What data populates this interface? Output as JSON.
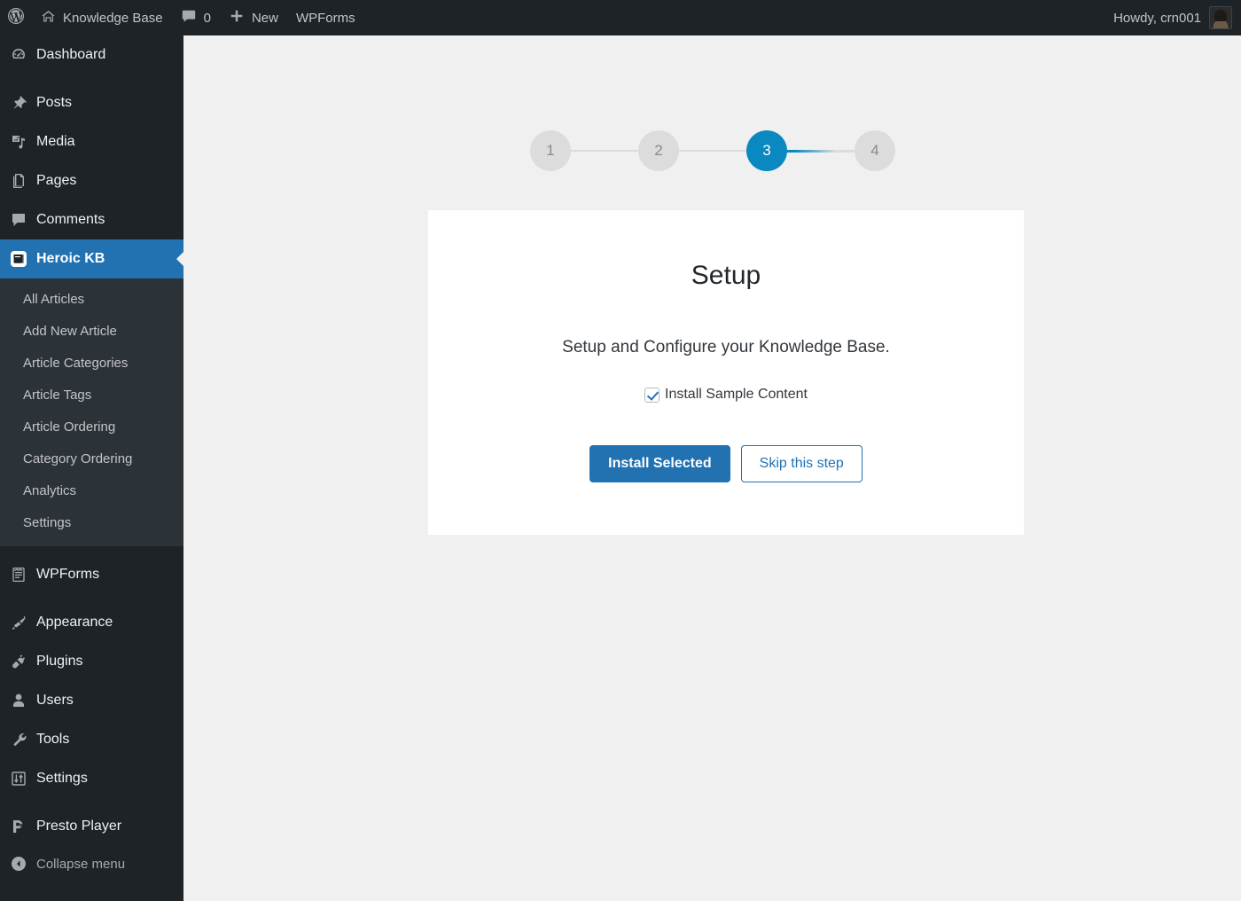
{
  "adminbar": {
    "wp_logo": "wordpress-logo",
    "site_name": "Knowledge Base",
    "comments_count": "0",
    "new_label": "New",
    "wpforms_label": "WPForms",
    "howdy": "Howdy, crn001"
  },
  "sidebar": {
    "items": [
      {
        "label": "Dashboard",
        "icon": "dashboard-icon",
        "current": false,
        "sep_after": true
      },
      {
        "label": "Posts",
        "icon": "pin-icon",
        "current": false,
        "sep_after": false
      },
      {
        "label": "Media",
        "icon": "media-icon",
        "current": false,
        "sep_after": false
      },
      {
        "label": "Pages",
        "icon": "pages-icon",
        "current": false,
        "sep_after": false
      },
      {
        "label": "Comments",
        "icon": "comment-icon",
        "current": false,
        "sep_after": false
      },
      {
        "label": "Heroic KB",
        "icon": "book-icon",
        "current": true,
        "sep_after": false
      }
    ],
    "submenu": [
      "All Articles",
      "Add New Article",
      "Article Categories",
      "Article Tags",
      "Article Ordering",
      "Category Ordering",
      "Analytics",
      "Settings"
    ],
    "items_lower": [
      {
        "label": "WPForms",
        "icon": "form-icon",
        "sep_after": true
      },
      {
        "label": "Appearance",
        "icon": "brush-icon",
        "sep_after": false
      },
      {
        "label": "Plugins",
        "icon": "plug-icon",
        "sep_after": false
      },
      {
        "label": "Users",
        "icon": "user-icon",
        "sep_after": false
      },
      {
        "label": "Tools",
        "icon": "wrench-icon",
        "sep_after": false
      },
      {
        "label": "Settings",
        "icon": "sliders-icon",
        "sep_after": true
      },
      {
        "label": "Presto Player",
        "icon": "presto-player-icon",
        "sep_after": false
      }
    ],
    "collapse_label": "Collapse menu"
  },
  "wizard": {
    "steps": [
      {
        "number": "1",
        "active": false
      },
      {
        "number": "2",
        "active": false
      },
      {
        "number": "3",
        "active": true
      },
      {
        "number": "4",
        "active": false
      }
    ],
    "current_step": "3",
    "title": "Setup",
    "description": "Setup and Configure your Knowledge Base.",
    "checkbox_label": "Install Sample Content",
    "checkbox_checked": true,
    "primary_button": "Install Selected",
    "secondary_button": "Skip this step"
  },
  "colors": {
    "admin_dark": "#1d2327",
    "submenu_dark": "#2c3338",
    "accent_blue": "#2271b1",
    "step_active_blue": "#0a88c0",
    "page_bg": "#f0f0f1",
    "card_bg": "#ffffff",
    "step_gray": "#dcdcdc"
  }
}
